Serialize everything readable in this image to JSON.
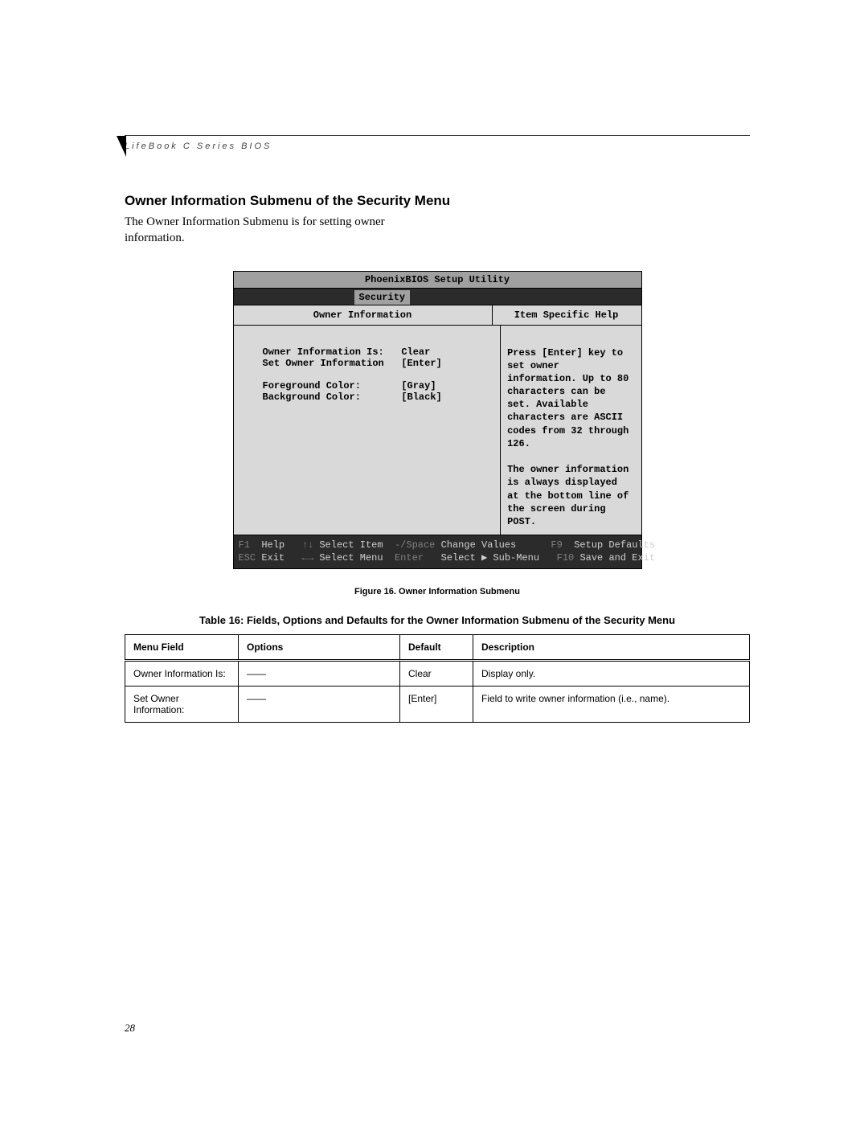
{
  "running_head": "LifeBook C Series BIOS",
  "heading": "Owner Information Submenu of the Security Menu",
  "intro": "The Owner Information Submenu is for setting owner information.",
  "bios": {
    "title": "PhoenixBIOS Setup Utility",
    "tab": "Security",
    "left_header": "Owner Information",
    "right_header": "Item Specific Help",
    "fields": [
      {
        "label": "Owner Information Is:",
        "value": "Clear"
      },
      {
        "label": "Set Owner Information",
        "value": "[Enter]"
      },
      {
        "label": "",
        "value": ""
      },
      {
        "label": "Foreground Color:",
        "value": "[Gray]"
      },
      {
        "label": "Background Color:",
        "value": "[Black]"
      }
    ],
    "help_text": "Press [Enter] key to set owner information. Up to 80 characters can be set. Available characters are ASCII codes from 32 through 126.\n\nThe owner information is always displayed at the bottom line of the screen during POST.",
    "footer": {
      "f1": "F1",
      "help": "Help",
      "ud": "↑↓",
      "select_item": "Select Item",
      "minus": "-/Space",
      "change_values": "Change Values",
      "f9": "F9",
      "setup_defaults": "Setup Defaults",
      "esc": "ESC",
      "exit": "Exit",
      "lr": "←→",
      "select_menu": "Select Menu",
      "enter": "Enter",
      "select_sub": "Select ▶ Sub-Menu",
      "f10": "F10",
      "save_exit": "Save and Exit"
    }
  },
  "figure_caption": "Figure 16.  Owner Information Submenu",
  "table_caption": "Table 16: Fields, Options and Defaults for the Owner Information Submenu of the Security Menu",
  "table": {
    "headers": [
      "Menu Field",
      "Options",
      "Default",
      "Description"
    ],
    "rows": [
      {
        "field": "Owner Information Is:",
        "options": "——",
        "default": "Clear",
        "desc": "Display only."
      },
      {
        "field": "Set Owner Information:",
        "options": "——",
        "default": "[Enter]",
        "desc": "Field to write owner information (i.e., name)."
      }
    ]
  },
  "page_number": "28"
}
